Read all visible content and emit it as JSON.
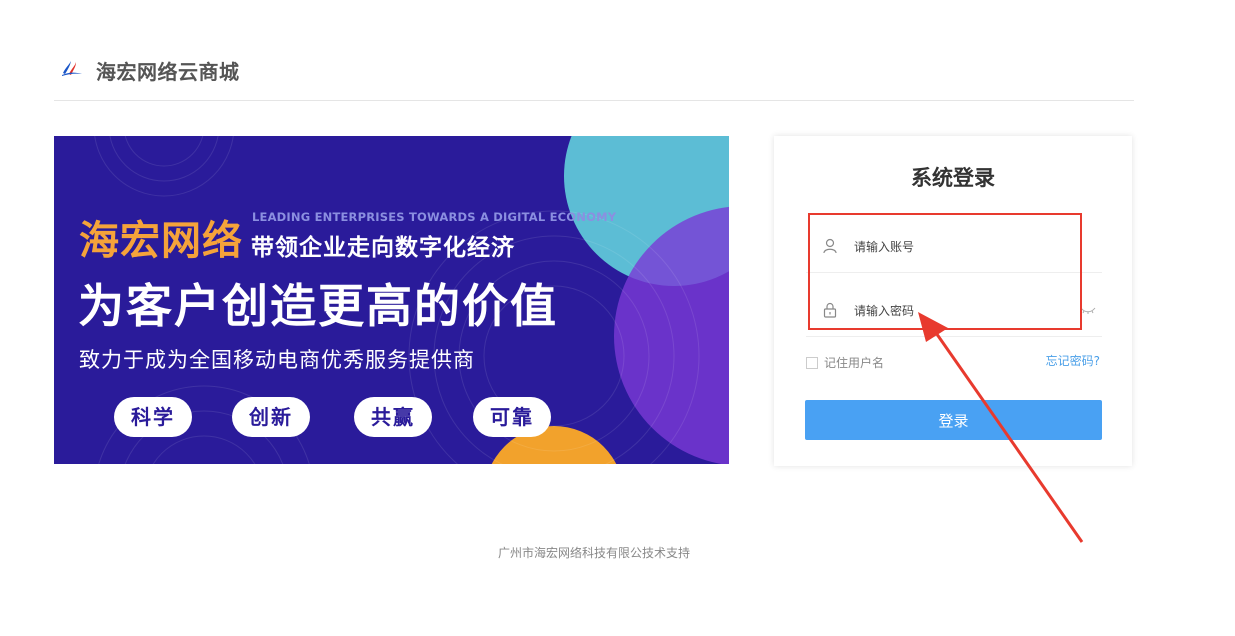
{
  "header": {
    "site_title": "海宏网络云商城"
  },
  "banner": {
    "brand": "海宏网络",
    "tagline_en": "LEADING ENTERPRISES TOWARDS A DIGITAL ECONOMY",
    "tagline_cn": "带领企业走向数字化经济",
    "headline": "为客户创造更高的价值",
    "subline": "致力于成为全国移动电商优秀服务提供商",
    "pills": [
      "科学",
      "创新",
      "共赢",
      "可靠"
    ]
  },
  "login": {
    "title": "系统登录",
    "username_placeholder": "请输入账号",
    "password_placeholder": "请输入密码",
    "remember_label": "记住用户名",
    "forgot_label": "忘记密码?",
    "submit_label": "登录"
  },
  "footer": {
    "text": "广州市海宏网络科技有限公技术支持"
  },
  "colors": {
    "accent": "#49a1f3",
    "annotation": "#e83a2e",
    "banner_bg": "#2a1b9a",
    "brand_orange": "#f5a33a"
  }
}
